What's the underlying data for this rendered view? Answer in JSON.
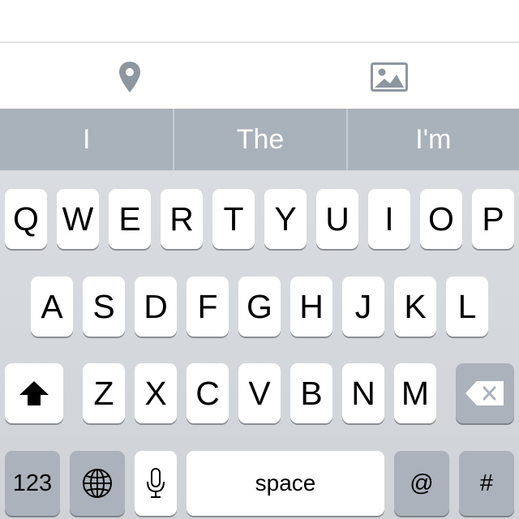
{
  "attachments": {
    "location_icon": "location-pin-icon",
    "photo_icon": "photo-icon"
  },
  "suggestions": [
    "I",
    "The",
    "I'm"
  ],
  "keyboard": {
    "row1": [
      "Q",
      "W",
      "E",
      "R",
      "T",
      "Y",
      "U",
      "I",
      "O",
      "P"
    ],
    "row2": [
      "A",
      "S",
      "D",
      "F",
      "G",
      "H",
      "J",
      "K",
      "L"
    ],
    "row3": [
      "Z",
      "X",
      "C",
      "V",
      "B",
      "N",
      "M"
    ],
    "shift_icon": "shift-arrow-icon",
    "delete_icon": "delete-backspace-icon",
    "numbers_label": "123",
    "globe_icon": "globe-icon",
    "mic_icon": "microphone-icon",
    "space_label": "space",
    "at_label": "@",
    "hash_label": "#"
  },
  "colors": {
    "suggestion_bar": "#a9b1bb",
    "keyboard_bg": "#d3d6db",
    "dark_key": "#abb2bb",
    "icon_gray": "#8e969f"
  }
}
